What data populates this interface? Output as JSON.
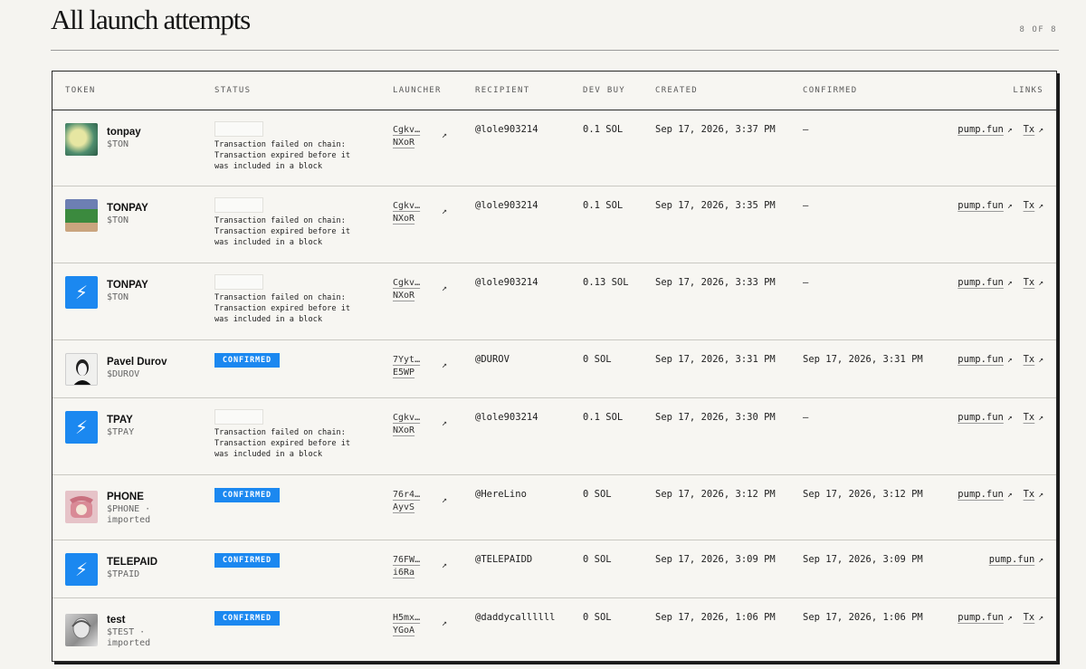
{
  "page": {
    "title": "All launch attempts",
    "count": "8 OF 8"
  },
  "columns": {
    "token": "TOKEN",
    "status": "STATUS",
    "launcher": "LAUNCHER",
    "recipient": "RECIPIENT",
    "dev_buy": "DEV BUY",
    "created": "CREATED",
    "confirmed": "CONFIRMED",
    "links": "LINKS"
  },
  "labels": {
    "arrow": "↗",
    "pump": "pump.fun",
    "tx": "Tx"
  },
  "rows": [
    {
      "name": "tonpay",
      "ticker": "$TON",
      "imported": "",
      "avatar": "coin-avatar",
      "status_confirmed": false,
      "status_badge": "",
      "status_error": "Transaction failed on chain: Transaction expired before it was included in a block",
      "launcher_top": "Cgkv…",
      "launcher_bottom": "NXoR",
      "recipient": "@lole903214",
      "dev_buy": "0.1 SOL",
      "created": "Sep 17, 2026, 3:37 PM",
      "confirmed": "—",
      "has_tx": true
    },
    {
      "name": "TONPAY",
      "ticker": "$TON",
      "imported": "",
      "avatar": "pepe-avatar",
      "status_confirmed": false,
      "status_badge": "",
      "status_error": "Transaction failed on chain: Transaction expired before it was included in a block",
      "launcher_top": "Cgkv…",
      "launcher_bottom": "NXoR",
      "recipient": "@lole903214",
      "dev_buy": "0.1 SOL",
      "created": "Sep 17, 2026, 3:35 PM",
      "confirmed": "—",
      "has_tx": true
    },
    {
      "name": "TONPAY",
      "ticker": "$TON",
      "imported": "",
      "avatar": "lightning-icon",
      "status_confirmed": false,
      "status_badge": "",
      "status_error": "Transaction failed on chain: Transaction expired before it was included in a block",
      "launcher_top": "Cgkv…",
      "launcher_bottom": "NXoR",
      "recipient": "@lole903214",
      "dev_buy": "0.13 SOL",
      "created": "Sep 17, 2026, 3:33 PM",
      "confirmed": "—",
      "has_tx": true
    },
    {
      "name": "Pavel Durov",
      "ticker": "$DUROV",
      "imported": "",
      "avatar": "portrait-avatar",
      "status_confirmed": true,
      "status_badge": "CONFIRMED",
      "status_error": "",
      "launcher_top": "7Yyt…",
      "launcher_bottom": "E5WP",
      "recipient": "@DUROV",
      "dev_buy": "0 SOL",
      "created": "Sep 17, 2026, 3:31 PM",
      "confirmed": "Sep 17, 2026, 3:31 PM",
      "has_tx": true
    },
    {
      "name": "TPAY",
      "ticker": "$TPAY",
      "imported": "",
      "avatar": "lightning-icon",
      "status_confirmed": false,
      "status_badge": "",
      "status_error": "Transaction failed on chain: Transaction expired before it was included in a block",
      "launcher_top": "Cgkv…",
      "launcher_bottom": "NXoR",
      "recipient": "@lole903214",
      "dev_buy": "0.1 SOL",
      "created": "Sep 17, 2026, 3:30 PM",
      "confirmed": "—",
      "has_tx": true
    },
    {
      "name": "PHONE",
      "ticker": "$PHONE ·",
      "imported": "imported",
      "avatar": "phone-avatar",
      "status_confirmed": true,
      "status_badge": "CONFIRMED",
      "status_error": "",
      "launcher_top": "76r4…",
      "launcher_bottom": "AyvS",
      "recipient": "@HereLino",
      "dev_buy": "0 SOL",
      "created": "Sep 17, 2026, 3:12 PM",
      "confirmed": "Sep 17, 2026, 3:12 PM",
      "has_tx": true
    },
    {
      "name": "TELEPAID",
      "ticker": "$TPAID",
      "imported": "",
      "avatar": "lightning-icon",
      "status_confirmed": true,
      "status_badge": "CONFIRMED",
      "status_error": "",
      "launcher_top": "76FW…",
      "launcher_bottom": "i6Ra",
      "recipient": "@TELEPAIDD",
      "dev_buy": "0 SOL",
      "created": "Sep 17, 2026, 3:09 PM",
      "confirmed": "Sep 17, 2026, 3:09 PM",
      "has_tx": false
    },
    {
      "name": "test",
      "ticker": "$TEST ·",
      "imported": "imported",
      "avatar": "sketch-avatar",
      "status_confirmed": true,
      "status_badge": "CONFIRMED",
      "status_error": "",
      "launcher_top": "H5mx…",
      "launcher_bottom": "YGoA",
      "recipient": "@daddycallllll",
      "dev_buy": "0 SOL",
      "created": "Sep 17, 2026, 1:06 PM",
      "confirmed": "Sep 17, 2026, 1:06 PM",
      "has_tx": true
    }
  ]
}
